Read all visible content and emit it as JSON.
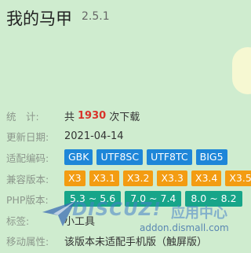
{
  "app": {
    "title": "我的马甲",
    "version": "2.5.1"
  },
  "stats": {
    "label": "统　计:",
    "prefix": "共",
    "count": "1930",
    "suffix": "次下载"
  },
  "updated": {
    "label": "更新日期:",
    "value": "2021-04-14"
  },
  "encoding": {
    "label": "适配编码:",
    "tags": [
      "GBK",
      "UTF8SC",
      "UTF8TC",
      "BIG5"
    ]
  },
  "compat": {
    "label": "兼容版本:",
    "tags": [
      "X3",
      "X3.1",
      "X3.2",
      "X3.3",
      "X3.4",
      "X3.5"
    ]
  },
  "php": {
    "label": "PHP版本:",
    "tags": [
      "5.3 ~ 5.6",
      "7.0 ~ 7.4",
      "8.0 ~ 8.2"
    ]
  },
  "tag_row": {
    "label": "标签:",
    "value": "小工具"
  },
  "mobile": {
    "label": "移动属性:",
    "value": "该版本未适配手机版（触屏版）"
  },
  "watermark": {
    "brand": "DISCUZ!",
    "text": "应用中心",
    "url": "addon.dismall.com"
  },
  "colors": {
    "background": "#cfeccf",
    "count": "#d9342b",
    "encoding_tag": "#1e86d8",
    "compat_tag": "#f39c12",
    "php_tag": "#17a589"
  }
}
